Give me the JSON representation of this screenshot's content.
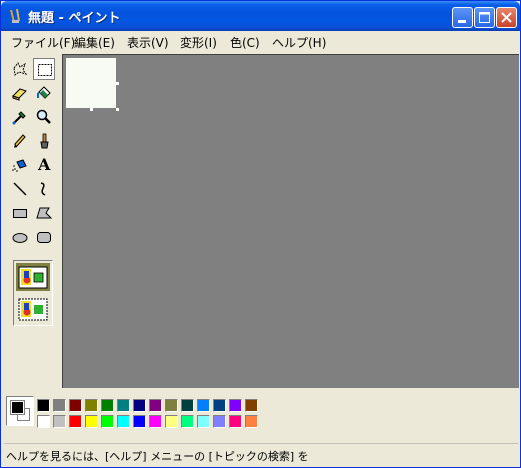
{
  "window": {
    "title": "無題 - ペイント",
    "accent": "#0453de"
  },
  "menu": {
    "items": [
      {
        "label": "ファイル(F)"
      },
      {
        "label": "編集(E)"
      },
      {
        "label": "表示(V)"
      },
      {
        "label": "変形(I)"
      },
      {
        "label": "色(C)"
      },
      {
        "label": "ヘルプ(H)"
      }
    ]
  },
  "tools": [
    {
      "name": "free-form-select-icon"
    },
    {
      "name": "rect-select-icon",
      "selected": true
    },
    {
      "name": "eraser-icon"
    },
    {
      "name": "fill-bucket-icon"
    },
    {
      "name": "color-picker-icon"
    },
    {
      "name": "magnifier-icon"
    },
    {
      "name": "pencil-icon"
    },
    {
      "name": "brush-icon"
    },
    {
      "name": "airbrush-icon"
    },
    {
      "name": "text-icon"
    },
    {
      "name": "line-icon"
    },
    {
      "name": "curve-icon"
    },
    {
      "name": "rectangle-icon"
    },
    {
      "name": "polygon-icon"
    },
    {
      "name": "ellipse-icon"
    },
    {
      "name": "rounded-rect-icon"
    }
  ],
  "text_tool_glyph": "A",
  "palette": {
    "foreground": "#000000",
    "background": "#ffffff",
    "colors_top": [
      "#000000",
      "#808080",
      "#800000",
      "#808000",
      "#008000",
      "#008080",
      "#000080",
      "#800080",
      "#808040",
      "#004040",
      "#0080ff",
      "#004080",
      "#8000ff",
      "#804000"
    ],
    "colors_bottom": [
      "#ffffff",
      "#c0c0c0",
      "#ff0000",
      "#ffff00",
      "#00ff00",
      "#00ffff",
      "#0000ff",
      "#ff00ff",
      "#ffff80",
      "#00ff80",
      "#80ffff",
      "#8080ff",
      "#ff0080",
      "#ff8040"
    ]
  },
  "status": {
    "text": "ヘルプを見るには、[ヘルプ] メニューの [トピックの検索] を"
  }
}
